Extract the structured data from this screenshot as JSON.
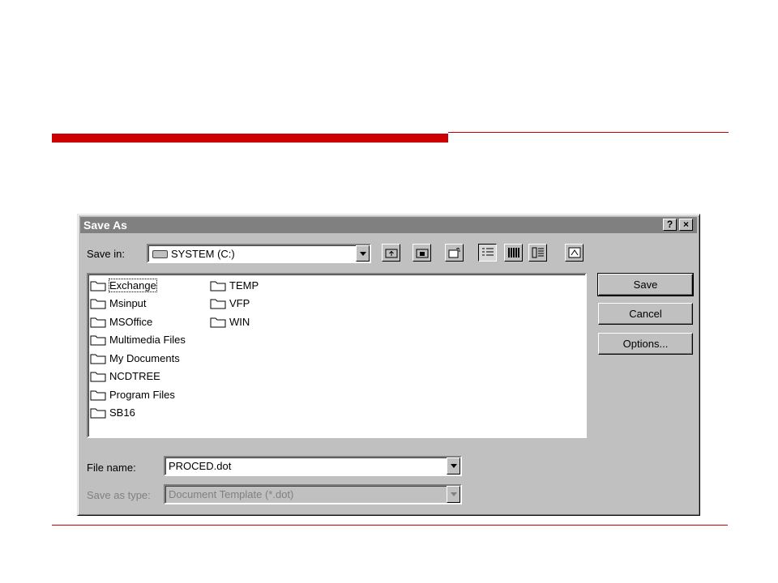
{
  "dialog": {
    "title": "Save As",
    "help_label": "?",
    "close_label": "×"
  },
  "save_in": {
    "label": "Save in:",
    "value": "SYSTEM (C:)"
  },
  "toolbar": [
    "up-one-level",
    "create-new-folder",
    "view-desktop",
    "list-view",
    "details-view",
    "properties-view",
    "commands-view"
  ],
  "folders": [
    "Exchange",
    "Msinput",
    "MSOffice",
    "Multimedia Files",
    "My Documents",
    "NCDTREE",
    "Program Files",
    "SB16",
    "TEMP",
    "VFP",
    "WIN"
  ],
  "file_name": {
    "label": "File name:",
    "value": "PROCED.dot"
  },
  "save_as_type": {
    "label": "Save as type:",
    "value": "Document Template (*.dot)"
  },
  "buttons": {
    "save": "Save",
    "cancel": "Cancel",
    "options": "Options..."
  }
}
